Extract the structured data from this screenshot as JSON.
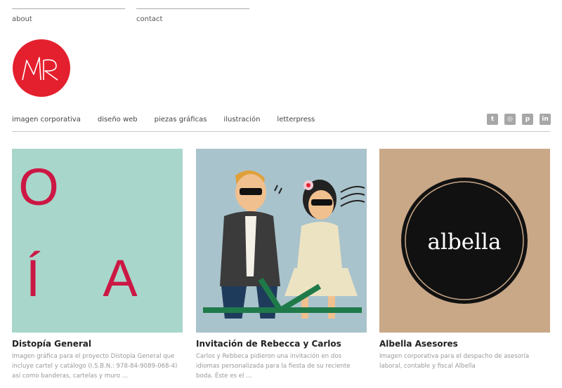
{
  "top_links": {
    "about": "about",
    "contact": "contact"
  },
  "logo": {
    "text": "MR",
    "color": "#e4202e"
  },
  "nav": {
    "items": [
      "imagen corporativa",
      "diseño web",
      "piezas gráficas",
      "ilustración",
      "letterpress"
    ]
  },
  "social": {
    "icons": [
      {
        "name": "twitter-icon",
        "glyph": "t"
      },
      {
        "name": "instagram-icon",
        "glyph": "◎"
      },
      {
        "name": "pinterest-icon",
        "glyph": "p"
      },
      {
        "name": "linkedin-icon",
        "glyph": "in"
      }
    ],
    "color": "#a7a7a7"
  },
  "projects": [
    {
      "title": "Distopía General",
      "description": "Imagen gráfica para el proyecto Distopía General que incluye cartel y catálogo (I.S.B.N.: 978-84-9089-068-4) así como banderas, cartelas y muro ...",
      "thumb_letters": [
        "O",
        "Í",
        "A"
      ],
      "thumb_bg": "#a8d6ca",
      "thumb_fg": "#cc1744"
    },
    {
      "title": "Invitación de Rebecca y Carlos",
      "description": "Carlos y Rebbeca pidieron una invitación en dos idiomas personalizada para la fiesta de su reciente boda. Éste es el ...",
      "thumb_bg": "#a9c3cc"
    },
    {
      "title": "Albella Asesores",
      "description": "Imagen corporativa para el despacho de asesoría laboral, contable y fiscal Albella",
      "thumb_word": "albella",
      "thumb_bg": "#c9a888"
    }
  ]
}
